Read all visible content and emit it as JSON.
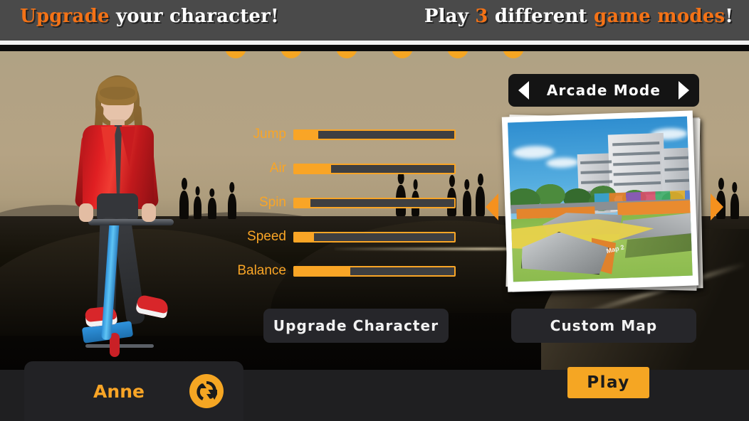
{
  "banner": {
    "left": {
      "highlight": "Upgrade",
      "rest": " your character!"
    },
    "right": {
      "pre": "Play ",
      "num": "3",
      "mid": " different ",
      "highlight": "game modes",
      "post": "!"
    }
  },
  "character": {
    "name": "Anne",
    "swap_icon": "refresh-swap-icon",
    "stats": [
      {
        "label": "Jump",
        "fill_pct": 14
      },
      {
        "label": "Air",
        "fill_pct": 22
      },
      {
        "label": "Spin",
        "fill_pct": 9
      },
      {
        "label": "Speed",
        "fill_pct": 11
      },
      {
        "label": "Balance",
        "fill_pct": 34
      }
    ]
  },
  "mode": {
    "title": "Arcade Mode",
    "prev_icon": "chevron-left-icon",
    "next_icon": "chevron-right-icon"
  },
  "map": {
    "prev_icon": "chevron-left-icon",
    "next_icon": "chevron-right-icon",
    "preview_alt": "skatepark-map-preview",
    "watermark": "Map 2"
  },
  "buttons": {
    "upgrade_character": "Upgrade Character",
    "custom_map": "Custom Map",
    "play": "Play"
  },
  "colors": {
    "accent_orange": "#f5a623",
    "banner_orange": "#f47216",
    "banner_bg": "#4a4a4a",
    "panel_dark": "#26262a"
  }
}
